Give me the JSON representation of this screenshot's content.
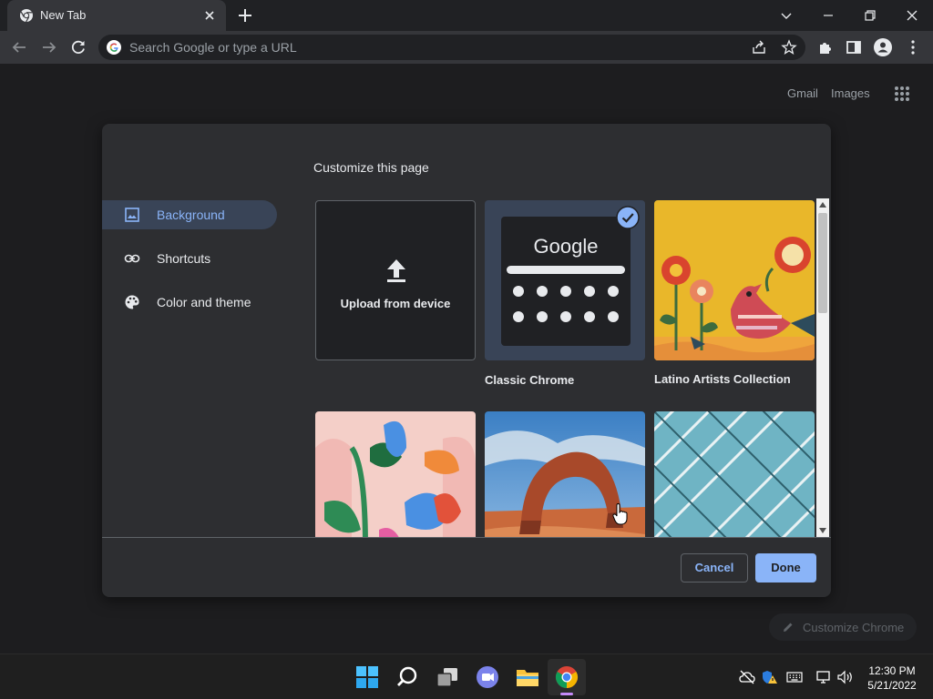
{
  "browser": {
    "tab": {
      "title": "New Tab"
    },
    "omnibox": {
      "placeholder": "Search Google or type a URL"
    }
  },
  "page": {
    "top_links": {
      "gmail": "Gmail",
      "images": "Images"
    },
    "customize_chrome_label": "Customize Chrome"
  },
  "dialog": {
    "title": "Customize this page",
    "sidebar": [
      {
        "label": "Background",
        "icon": "image-icon",
        "active": true
      },
      {
        "label": "Shortcuts",
        "icon": "link-icon",
        "active": false
      },
      {
        "label": "Color and theme",
        "icon": "palette-icon",
        "active": false
      }
    ],
    "tiles": [
      {
        "label": "Upload from device",
        "type": "upload"
      },
      {
        "label": "Classic Chrome",
        "type": "classic",
        "selected": true,
        "google_word": "Google"
      },
      {
        "label": "Latino Artists Collection",
        "type": "collection"
      }
    ],
    "buttons": {
      "cancel": "Cancel",
      "done": "Done"
    }
  },
  "taskbar": {
    "time": "12:30 PM",
    "date": "5/21/2022"
  },
  "colors": {
    "accent": "#8ab4f8",
    "dialog_bg": "#2d2e31",
    "selected_bg": "#394457"
  }
}
